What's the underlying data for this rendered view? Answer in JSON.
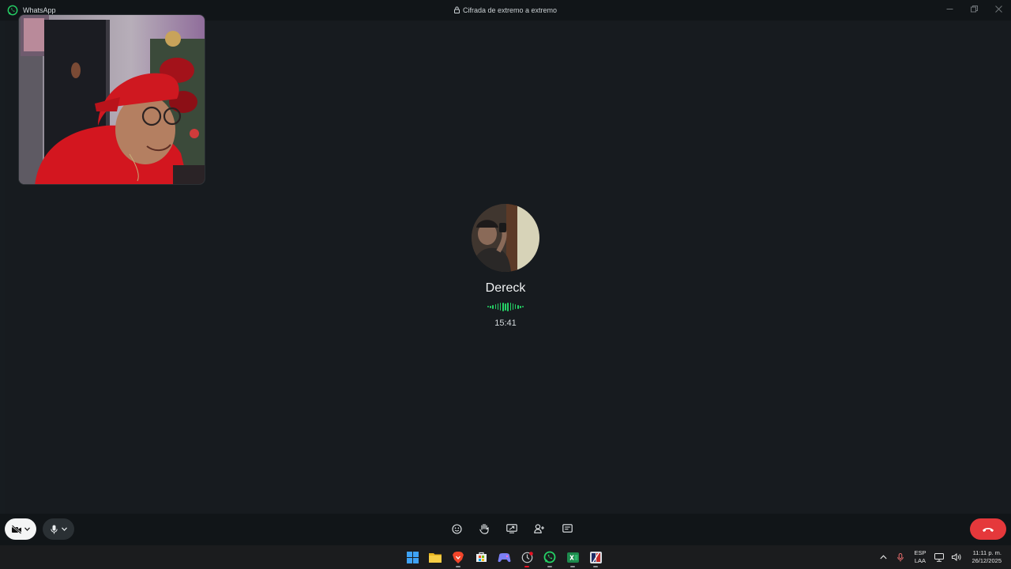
{
  "window": {
    "app_name": "WhatsApp",
    "encryption_text": "Cifrada de extremo a extremo",
    "controls": [
      "minimize",
      "maximize",
      "close"
    ]
  },
  "call": {
    "contact_name": "Dereck",
    "duration": "15:41",
    "status": "voice-activity",
    "accent_color": "#25d366",
    "end_call_color": "#e5383b"
  },
  "self_view": {
    "description_icon": "camera-self-preview"
  },
  "controls": {
    "left": [
      {
        "name": "camera-toggle-button",
        "icon": "video-off-icon",
        "state": "off"
      },
      {
        "name": "microphone-button",
        "icon": "microphone-icon",
        "state": "on"
      }
    ],
    "center": [
      {
        "name": "reactions-button",
        "icon": "emoji-icon"
      },
      {
        "name": "raise-hand-button",
        "icon": "hand-icon"
      },
      {
        "name": "share-screen-button",
        "icon": "screen-share-icon"
      },
      {
        "name": "add-participant-button",
        "icon": "add-person-icon"
      },
      {
        "name": "chat-button",
        "icon": "message-icon"
      }
    ],
    "end": {
      "name": "end-call-button",
      "icon": "phone-hangup-icon"
    }
  },
  "taskbar": {
    "apps": [
      "windows-start-icon",
      "file-explorer-icon",
      "brave-browser-icon",
      "microsoft-store-icon",
      "game-app-icon",
      "clock-app-icon",
      "whatsapp-icon",
      "spreadsheet-app-icon",
      "editor-app-icon"
    ],
    "language_line1": "ESP",
    "language_line2": "LAA",
    "time": "11:11 p. m.",
    "date": "26/12/2025"
  }
}
